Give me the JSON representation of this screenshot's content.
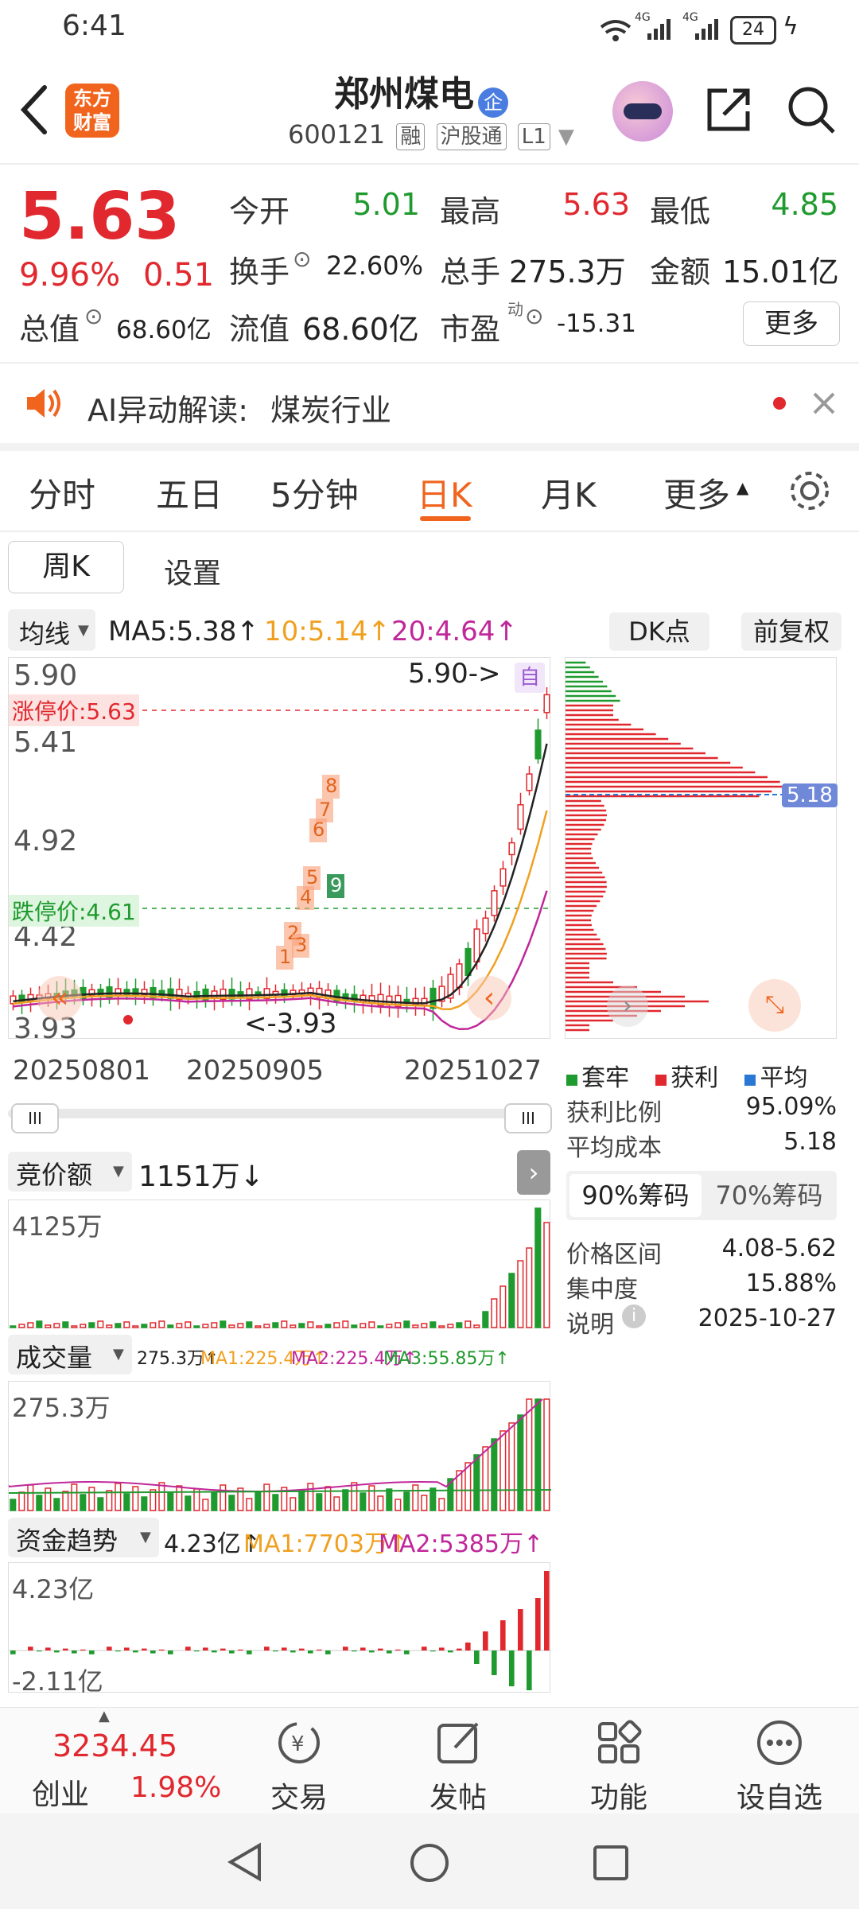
{
  "status_bar": {
    "time": "6:41",
    "battery": "24",
    "net1": "4G",
    "net2": "4G"
  },
  "header": {
    "app_logo_line1": "东方",
    "app_logo_line2": "财富",
    "title": "郑州煤电",
    "badge": "企",
    "code": "600121",
    "tags": [
      "融",
      "沪股通",
      "L1"
    ]
  },
  "quote": {
    "price": "5.63",
    "change_pct": "9.96%",
    "change_amt": "0.51",
    "open_label": "今开",
    "open": "5.01",
    "high_label": "最高",
    "high": "5.63",
    "low_label": "最低",
    "low": "4.85",
    "turnover_label": "换手",
    "turnover": "22.60%",
    "volume_label": "总手",
    "volume": "275.3万",
    "amount_label": "金额",
    "amount": "15.01亿",
    "mktcap_label": "总值",
    "mktcap": "68.60亿",
    "float_label": "流值",
    "float": "68.60亿",
    "pe_label": "市盈",
    "pe_sup": "动",
    "pe": "-15.31",
    "more_label": "更多"
  },
  "ai_banner": {
    "label": "AI异动解读:",
    "topic": "煤炭行业"
  },
  "tabs": [
    "分时",
    "五日",
    "5分钟",
    "日K",
    "月K",
    "更多"
  ],
  "active_tab": "日K",
  "subtabs": {
    "weekly": "周K",
    "settings": "设置"
  },
  "kline": {
    "ma_selector": "均线",
    "ma5": "MA5:5.38↑",
    "ma10": "10:5.14↑",
    "ma20": "20:4.64↑",
    "dk_label": "DK点",
    "adjust_label": "前复权",
    "limit_up": "涨停价:5.63",
    "limit_down": "跌停价:4.61",
    "y_labels": [
      "5.90",
      "5.41",
      "4.92",
      "4.42",
      "3.93"
    ],
    "max_marker": "5.90->",
    "min_marker": "<-3.93",
    "self_label": "自",
    "dates": [
      "20250801",
      "20250905",
      "20251027"
    ],
    "signal_marks": [
      "1",
      "2",
      "3",
      "4",
      "5",
      "6",
      "7",
      "8",
      "9"
    ]
  },
  "chip": {
    "avg_tag": "5.18",
    "legend": [
      "套牢",
      "获利",
      "平均"
    ],
    "profit_ratio_label": "获利比例",
    "profit_ratio": "95.09%",
    "avg_cost_label": "平均成本",
    "avg_cost": "5.18",
    "tab90": "90%筹码",
    "tab70": "70%筹码",
    "range_label": "价格区间",
    "range": "4.08-5.62",
    "concentration_label": "集中度",
    "concentration": "15.88%",
    "note_label": "说明",
    "note_date": "2025-10-27"
  },
  "auction": {
    "label": "竞价额",
    "value": "1151万↓",
    "axis_top": "4125万"
  },
  "volume": {
    "label": "成交量",
    "value": "275.3万↑",
    "ma1": "MA1:225.4万↑",
    "ma2": "MA2:225.4万↑",
    "ma3": "MA3:55.85万↑",
    "axis_top": "275.3万"
  },
  "fund": {
    "label": "资金趋势",
    "value": "4.23亿↑",
    "ma1": "MA1:7703万↑",
    "ma2": "MA2:5385万↑",
    "axis_top": "4.23亿",
    "axis_bottom": "-2.11亿"
  },
  "bottom_nav": {
    "index_value": "3234.45",
    "index_name": "创业",
    "index_pct": "1.98%",
    "items": [
      "交易",
      "发帖",
      "功能",
      "设自选"
    ]
  },
  "colors": {
    "up": "#e0282e",
    "down": "#1f9a2e",
    "accent": "#f0641e"
  }
}
